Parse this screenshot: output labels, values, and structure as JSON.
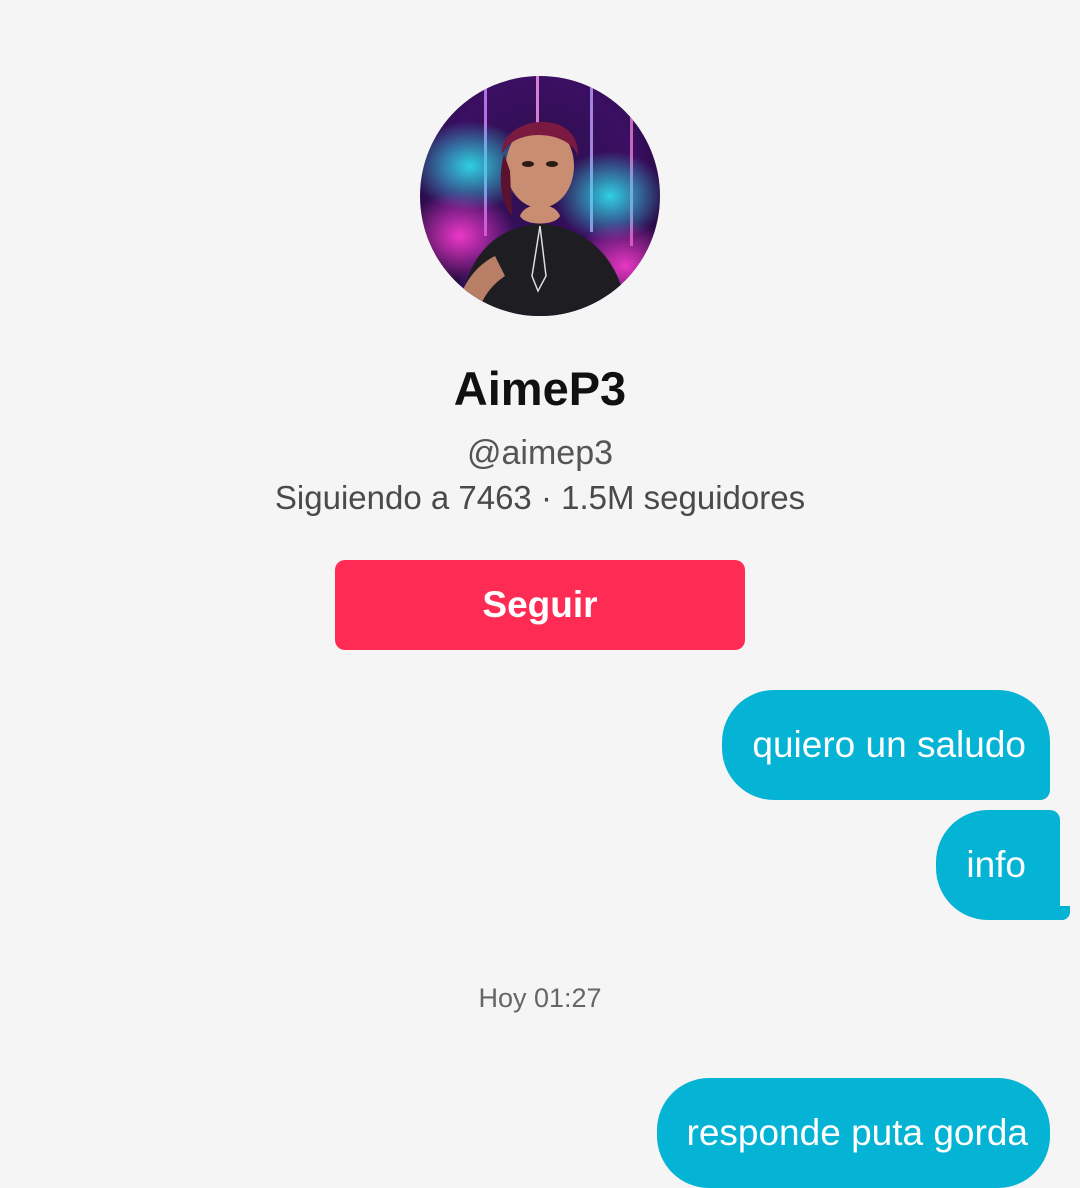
{
  "profile": {
    "display_name": "AimeP3",
    "username": "@aimep3",
    "stats": "Siguiendo a 7463 · 1.5M seguidores",
    "follow_label": "Seguir"
  },
  "messages": [
    {
      "text": "quiero un saludo",
      "sender": "me"
    },
    {
      "text": "info",
      "sender": "me"
    },
    {
      "text": "responde puta gorda",
      "sender": "me"
    }
  ],
  "timestamp": "Hoy 01:27",
  "colors": {
    "background": "#f5f5f5",
    "follow_button": "#fe2c55",
    "sent_bubble": "#05b3d4"
  }
}
